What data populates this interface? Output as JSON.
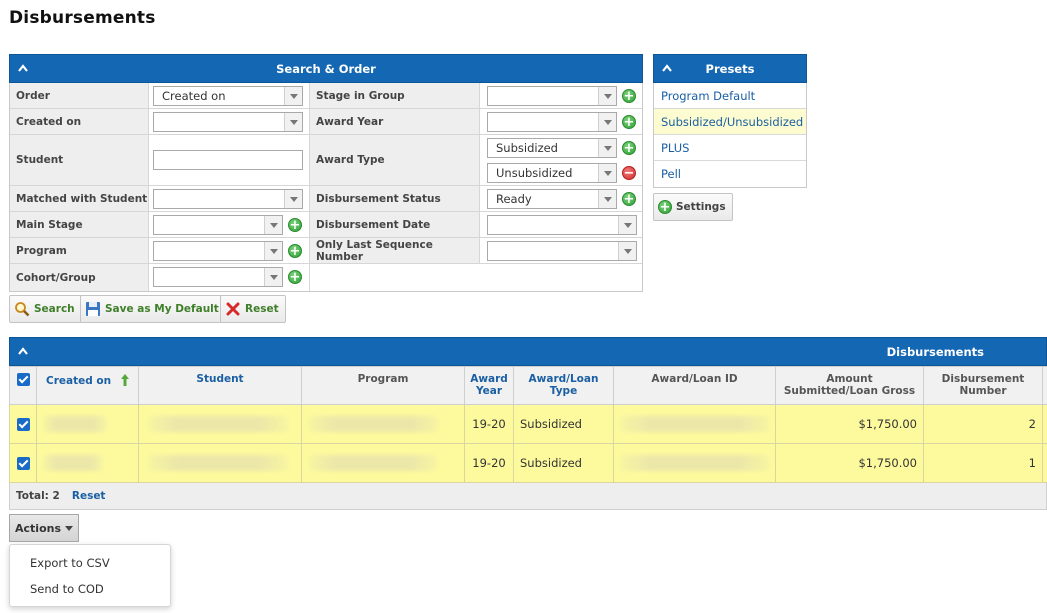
{
  "page": {
    "title": "Disbursements"
  },
  "search": {
    "header": "Search & Order",
    "labels": {
      "order": "Order",
      "created_on": "Created on",
      "student": "Student",
      "matched": "Matched with Student",
      "main_stage": "Main Stage",
      "program": "Program",
      "cohort": "Cohort/Group",
      "stage_in_group": "Stage in Group",
      "award_year": "Award Year",
      "award_type": "Award Type",
      "disb_status": "Disbursement Status",
      "disb_date": "Disbursement Date",
      "only_last": "Only Last Sequence Number"
    },
    "values": {
      "order": "Created on",
      "award_type_1": "Subsidized",
      "award_type_2": "Unsubsidized",
      "disb_status": "Ready"
    },
    "buttons": {
      "search": "Search",
      "save_default": "Save as My Default",
      "reset": "Reset"
    }
  },
  "presets": {
    "header": "Presets",
    "items": [
      "Program Default",
      "Subsidized/Unsubsidized",
      "PLUS",
      "Pell"
    ],
    "settings_label": "Settings"
  },
  "grid": {
    "header": "Disbursements",
    "columns": {
      "created_on": "Created on",
      "student": "Student",
      "program": "Program",
      "award_year_1": "Award",
      "award_year_2": "Year",
      "award_loan_type_1": "Award/Loan",
      "award_loan_type_2": "Type",
      "award_loan_id": "Award/Loan ID",
      "amount_1": "Amount",
      "amount_2": "Submitted/Loan Gross",
      "disb_number_1": "Disbursement",
      "disb_number_2": "Number"
    },
    "rows": [
      {
        "award_year": "19-20",
        "type": "Subsidized",
        "amount": "$1,750.00",
        "number": "2"
      },
      {
        "award_year": "19-20",
        "type": "Subsidized",
        "amount": "$1,750.00",
        "number": "1"
      }
    ],
    "footer": {
      "total": "Total: 2",
      "reset": "Reset"
    }
  },
  "actions": {
    "button_label": "Actions",
    "menu": [
      "Export to CSV",
      "Send to COD"
    ]
  },
  "colors": {
    "header_blue": "#1367b3",
    "row_highlight": "#fdfa9e",
    "link_blue": "#1a5fa3"
  }
}
